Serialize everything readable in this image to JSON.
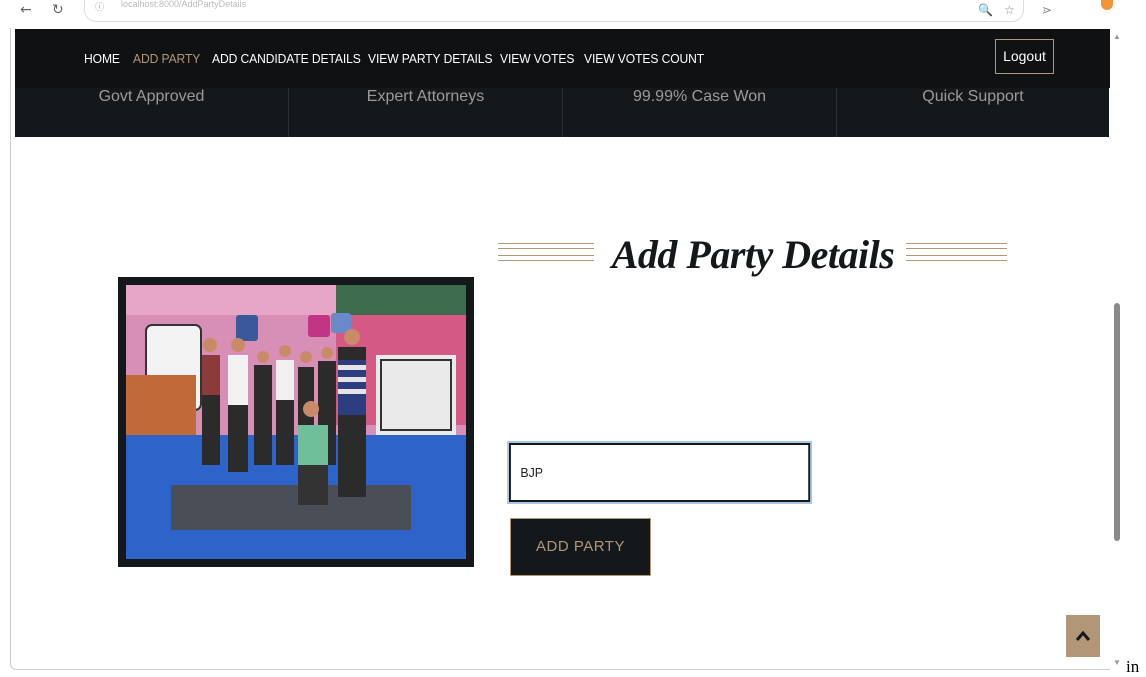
{
  "browser": {
    "back_glyph": "←",
    "reload_glyph": "↻",
    "url_text": "localhost:8000/AddPartyDetails",
    "zoom_glyph": "🔍",
    "star_glyph": "☆",
    "ext_glyph": "⋗"
  },
  "nav": {
    "items": [
      {
        "label": "HOME",
        "active": false
      },
      {
        "label": "ADD PARTY",
        "active": true
      },
      {
        "label": "ADD CANDIDATE DETAILS",
        "active": false
      },
      {
        "label": "VIEW PARTY DETAILS",
        "active": false
      },
      {
        "label": "VIEW VOTES",
        "active": false
      },
      {
        "label": "VIEW VOTES COUNT",
        "active": false
      }
    ],
    "logout_label": "Logout"
  },
  "features": [
    "Govt Approved",
    "Expert Attorneys",
    "99.99% Case Won",
    "Quick Support"
  ],
  "form": {
    "title": "Add Party Details",
    "party_input_value": "BJP",
    "submit_label": "ADD PARTY"
  },
  "back_to_top_glyph": "^",
  "trailing_text": "in",
  "colors": {
    "dark": "#15181b",
    "accent": "#b19777",
    "muted": "#9b9b9b"
  },
  "icons": [
    "back-arrow-icon",
    "reload-icon",
    "site-info-icon",
    "zoom-icon",
    "bookmark-star-icon",
    "extension-icon",
    "chevron-up-icon"
  ]
}
